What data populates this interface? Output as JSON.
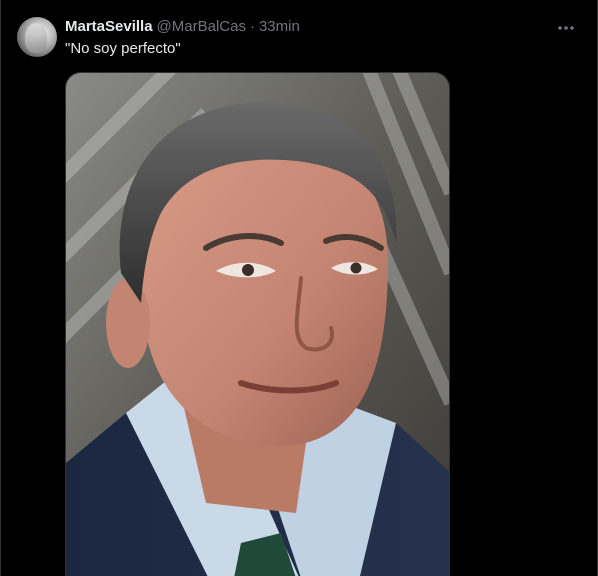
{
  "tweet": {
    "display_name": "MartaSevilla",
    "handle": "@MarBalCas",
    "separator": "·",
    "time": "33min",
    "text": "\"No soy perfecto\"",
    "more_icon": "more-horizontal-icon",
    "avatar_icon": "avatar"
  },
  "colors": {
    "background": "#000000",
    "primary_text": "#e7e9ea",
    "secondary_text": "#71767b",
    "border": "#2f3336"
  }
}
